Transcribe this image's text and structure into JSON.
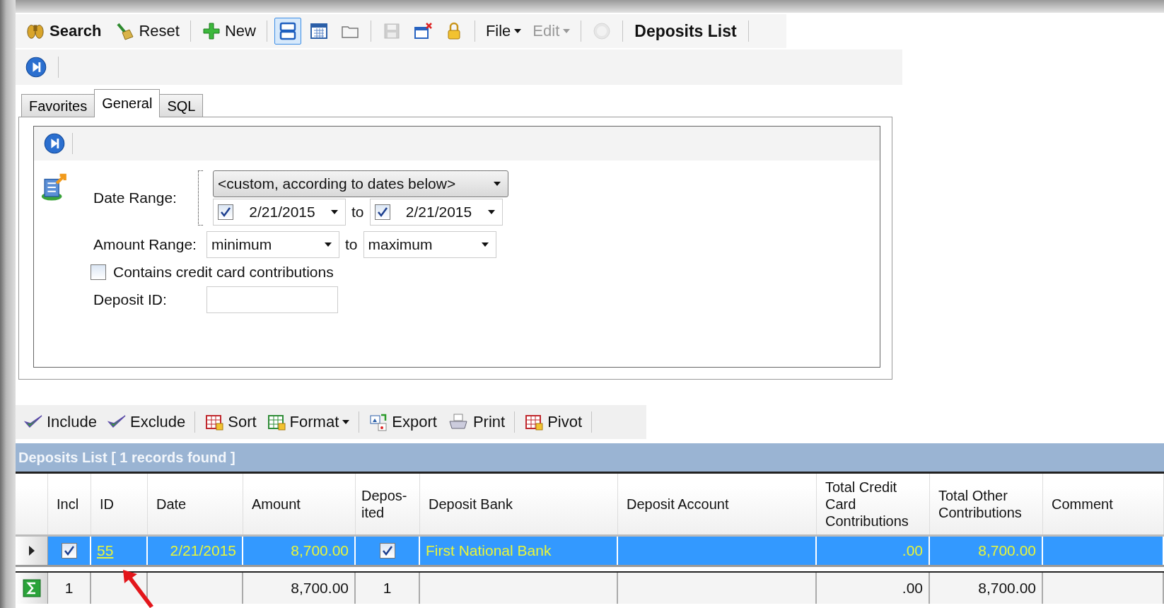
{
  "toolbar": [
    {
      "kind": "button",
      "label": "Search",
      "bold": true
    },
    {
      "kind": "button",
      "label": "Reset"
    },
    {
      "kind": "separator"
    },
    {
      "kind": "button",
      "label": "New"
    },
    {
      "kind": "separator"
    },
    {
      "kind": "icon",
      "selected": true
    },
    {
      "kind": "icon",
      "selected": false
    },
    {
      "kind": "icon",
      "selected": false
    },
    {
      "kind": "separator"
    },
    {
      "kind": "icon",
      "disabled": true
    },
    {
      "kind": "icon",
      "disabled": false
    },
    {
      "kind": "icon",
      "disabled": false
    },
    {
      "kind": "separator"
    },
    {
      "kind": "menu",
      "label": "File",
      "disabled": false
    },
    {
      "kind": "menu",
      "label": "Edit",
      "disabled": true
    },
    {
      "kind": "separator"
    },
    {
      "kind": "icon",
      "disabled": true
    },
    {
      "kind": "separator"
    },
    {
      "kind": "title",
      "label": "Deposits List"
    },
    {
      "kind": "separator"
    }
  ],
  "tabs": [
    {
      "label": "Favorites",
      "selected": false
    },
    {
      "label": "General",
      "selected": true
    },
    {
      "label": "SQL",
      "selected": false
    }
  ],
  "form": {
    "date_range": {
      "label": "Date Range:",
      "preset": "<custom, according to dates below>",
      "from": {
        "checked": true,
        "value": "2/21/2015"
      },
      "joiner": "to",
      "to": {
        "checked": true,
        "value": "2/21/2015"
      }
    },
    "amount_range": {
      "label": "Amount Range:",
      "from": "minimum",
      "joiner": "to",
      "to": "maximum"
    },
    "credit_card": {
      "label": "Contains credit card contributions",
      "checked": false
    },
    "deposit_id": {
      "label": "Deposit ID:"
    }
  },
  "grid_toolbar": [
    {
      "kind": "button",
      "label": "Include"
    },
    {
      "kind": "button",
      "label": "Exclude"
    },
    {
      "kind": "separator"
    },
    {
      "kind": "button",
      "label": "Sort"
    },
    {
      "kind": "menu",
      "label": "Format"
    },
    {
      "kind": "separator"
    },
    {
      "kind": "button",
      "label": "Export"
    },
    {
      "kind": "button",
      "label": "Print"
    },
    {
      "kind": "separator"
    },
    {
      "kind": "button",
      "label": "Pivot"
    },
    {
      "kind": "separator"
    }
  ],
  "grid": {
    "caption": "Deposits List [ 1 records found ]",
    "columns": [
      "Incl",
      "ID",
      "Date",
      "Amount",
      "Depos-ited",
      "Deposit Bank",
      "Deposit Account",
      "Total Credit Card Contributions",
      "Total Other Contributions",
      "Comment"
    ],
    "rows": [
      {
        "selected": true,
        "cells": [
          {
            "kind": "check",
            "checked": true
          },
          {
            "kind": "link",
            "text": "55"
          },
          {
            "kind": "number",
            "text": "2/21/2015"
          },
          {
            "kind": "number",
            "text": "8,700.00"
          },
          {
            "kind": "check",
            "checked": true
          },
          {
            "kind": "text",
            "text": "First National Bank"
          },
          {
            "kind": "empty"
          },
          {
            "kind": "number",
            "text": ".00"
          },
          {
            "kind": "number",
            "text": "8,700.00"
          },
          {
            "kind": "empty"
          }
        ]
      }
    ],
    "summary": [
      {
        "kind": "center",
        "text": "1"
      },
      {
        "kind": "empty"
      },
      {
        "kind": "empty"
      },
      {
        "kind": "number",
        "text": "8,700.00"
      },
      {
        "kind": "center",
        "text": "1"
      },
      {
        "kind": "empty"
      },
      {
        "kind": "empty"
      },
      {
        "kind": "number",
        "text": ".00"
      },
      {
        "kind": "number",
        "text": "8,700.00"
      },
      {
        "kind": "empty"
      }
    ]
  }
}
